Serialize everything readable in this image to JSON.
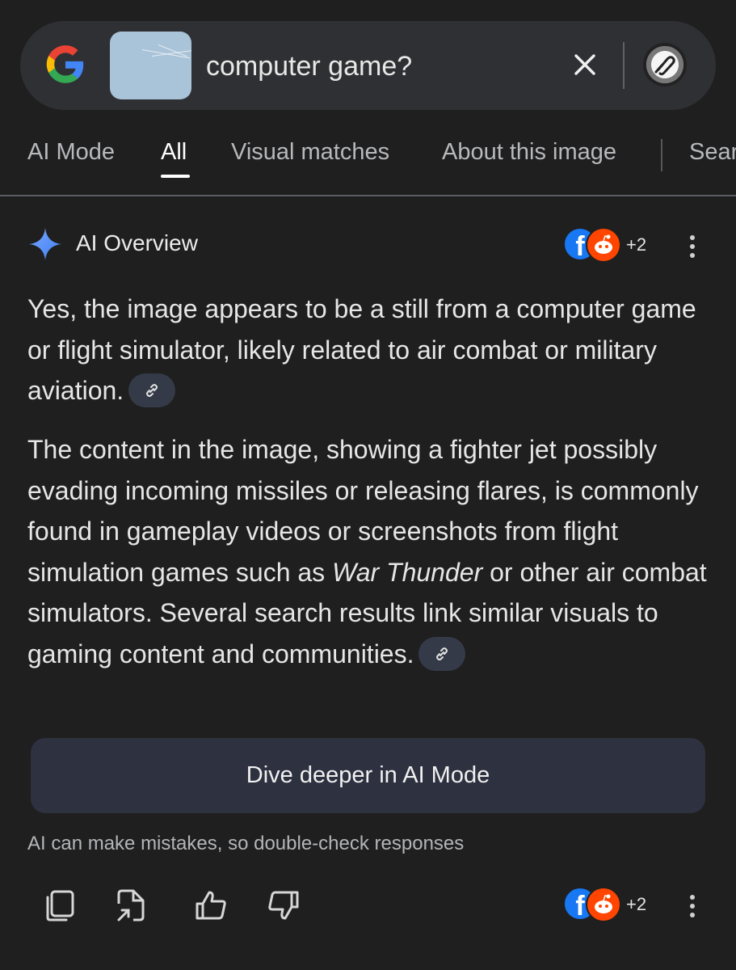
{
  "search": {
    "query": "computer game?",
    "icons": [
      "google-logo",
      "image-thumbnail",
      "close-icon",
      "lens-icon"
    ]
  },
  "tabs": [
    {
      "label": "AI Mode",
      "active": false
    },
    {
      "label": "All",
      "active": true
    },
    {
      "label": "Visual matches",
      "active": false
    },
    {
      "label": "About this image",
      "active": false
    },
    {
      "label": "Sear",
      "active": false
    }
  ],
  "overview": {
    "title": "AI Overview",
    "sources_more": "+2",
    "para1": "Yes, the image appears to be a still from a computer game or flight simulator, likely related to air combat or military aviation.",
    "para2_before": "The content in the image, showing a fighter jet possibly evading incoming missiles or releasing flares, is commonly found in gameplay videos or screenshots from flight simulation games such as ",
    "para2_em": "War Thunder",
    "para2_after": " or other air combat simulators. Several search results link similar visuals to gaming content and communities.",
    "dive_button": "Dive deeper in AI Mode",
    "disclaimer": "AI can make mistakes, so double-check responses",
    "footer_sources_more": "+2"
  },
  "colors": {
    "background": "#1f1f1f",
    "searchbar": "#2f3033",
    "chip": "#353a48",
    "button": "#2e3140",
    "spark": "#4c8df6",
    "facebook": "#1877f2",
    "reddit": "#ff4500"
  }
}
